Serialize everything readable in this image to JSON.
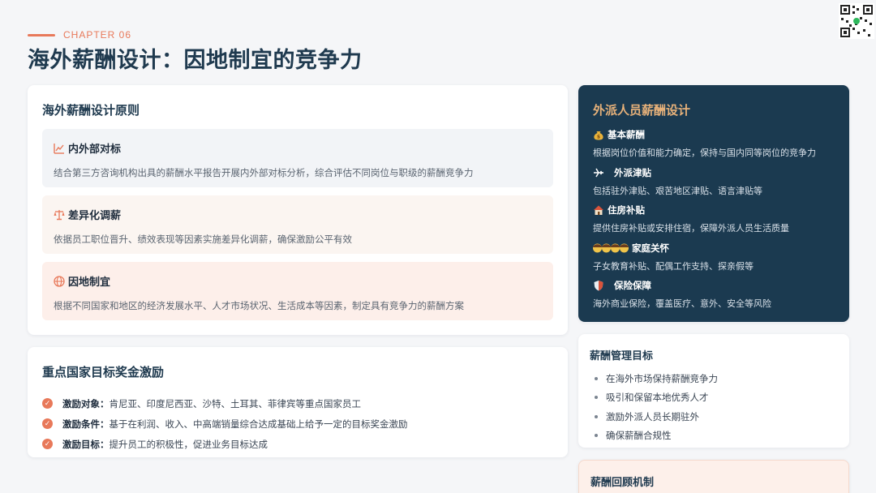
{
  "header": {
    "chapter": "CHAPTER 06",
    "title": "海外薪酬设计：因地制宜的竞争力"
  },
  "colors": {
    "accent": "#e8795a",
    "navy": "#1b3a50",
    "gold": "#e8b27a"
  },
  "principles": {
    "title": "海外薪酬设计原则",
    "items": [
      {
        "icon": "trend-chart-icon",
        "label": "内外部对标",
        "desc": "结合第三方咨询机构出具的薪酬水平报告开展内外部对标分析，综合评估不同岗位与职级的薪酬竞争力"
      },
      {
        "icon": "balance-scale-icon",
        "label": "差异化调薪",
        "desc": "依据员工职位晋升、绩效表现等因素实施差异化调薪，确保激励公平有效"
      },
      {
        "icon": "globe-icon",
        "label": "因地制宜",
        "desc": "根据不同国家和地区的经济发展水平、人才市场状况、生活成本等因素，制定具有竞争力的薪酬方案"
      }
    ]
  },
  "incentive": {
    "title": "重点国家目标奖金激励",
    "rows": [
      {
        "key": "激励对象：",
        "value": "肯尼亚、印度尼西亚、沙特、土耳其、菲律宾等重点国家员工"
      },
      {
        "key": "激励条件：",
        "value": "基于在利润、收入、中高端销量综合达成基础上给予一定的目标奖金激励"
      },
      {
        "key": "激励目标：",
        "value": "提升员工的积极性，促进业务目标达成"
      }
    ]
  },
  "expat": {
    "title": "外派人员薪酬设计",
    "items": [
      {
        "icon": "money-bag-icon",
        "label": "基本薪酬",
        "desc": "根据岗位价值和能力确定，保持与国内同等岗位的竞争力"
      },
      {
        "icon": "airplane-icon",
        "label": "外派津贴",
        "desc": "包括驻外津贴、艰苦地区津贴、语言津贴等"
      },
      {
        "icon": "house-icon",
        "label": "住房补贴",
        "desc": "提供住房补贴或安排住宿，保障外派人员生活质量"
      },
      {
        "icon": "family-icon",
        "label": "家庭关怀",
        "desc": "子女教育补贴、配偶工作支持、探亲假等"
      },
      {
        "icon": "shield-icon",
        "label": "保险保障",
        "desc": "海外商业保险，覆盖医疗、意外、安全等风险"
      }
    ]
  },
  "goals": {
    "title": "薪酬管理目标",
    "items": [
      "在海外市场保持薪酬竞争力",
      "吸引和保留本地优秀人才",
      "激励外派人员长期驻外",
      "确保薪酬合规性"
    ]
  },
  "review": {
    "title": "薪酬回顾机制"
  }
}
